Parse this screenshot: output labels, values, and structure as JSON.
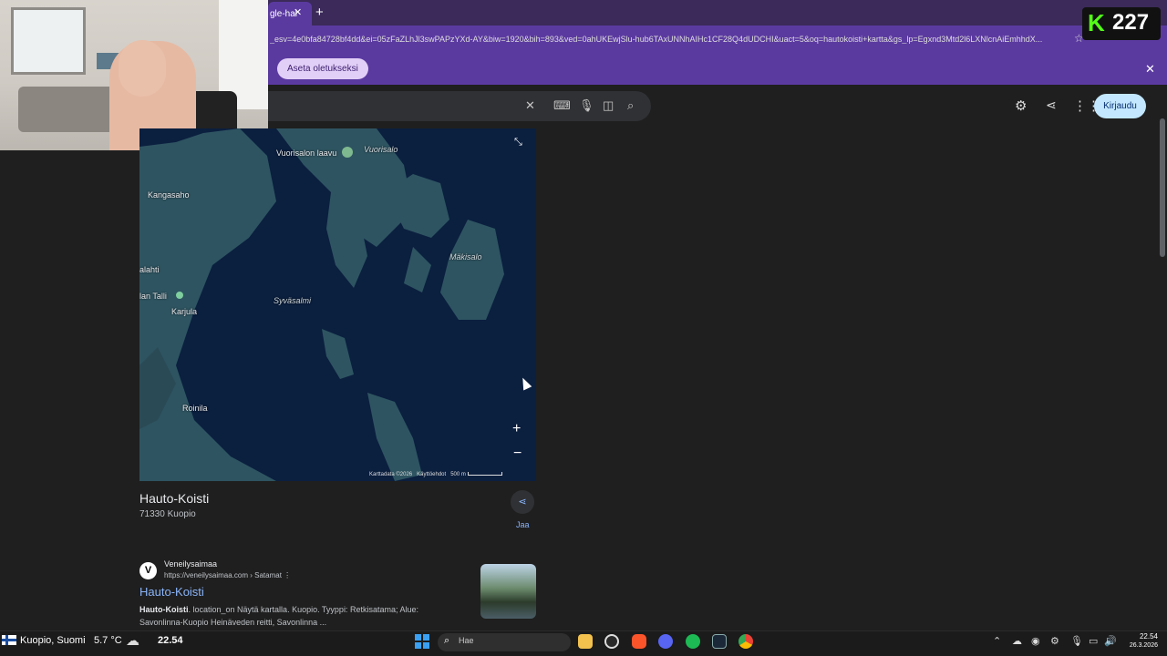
{
  "browser": {
    "tab_title": "gle-hal",
    "url": "_esv=4e0bfa84728bf4dd&ei=05zFaZLhJl3swPAPzYXd-AY&biw=1920&bih=893&ved=0ahUKEwjSlu-hub6TAxUNNhAIHc1CF28Q4dUDCHI&uact=5&oq=hautokoisti+kartta&gs_lp=Egxnd3Mtd2l6LXNlcnAiEmhhdX...",
    "set_default_label": "Aseta oletukseksi"
  },
  "kick": {
    "count": "227",
    "logo_letter": "K"
  },
  "google": {
    "signin_label": "Kirjaudu"
  },
  "map": {
    "labels": {
      "vuorisalon_laavu": "Vuorisalon laavu",
      "vuorisalo": "Vuorisalo",
      "kangasaho": "Kangasaho",
      "makisalo": "Mäkisalo",
      "lahti": "alahti",
      "talli": "lan Talli",
      "karjula": "Karjula",
      "syvasalmi": "Syväsalmi",
      "roinila": "Roinila"
    },
    "footer": {
      "data": "Karttadata ©2026",
      "terms": "Käyttöehdot",
      "scale": "500 m"
    }
  },
  "place": {
    "name": "Hauto-Koisti",
    "address": "71330 Kuopio",
    "share_label": "Jaa"
  },
  "result": {
    "site_name": "Veneilysaimaa",
    "url": "https://veneilysaimaa.com › Satamat",
    "title": "Hauto-Koisti",
    "desc_bold": "Hauto-Koisti",
    "desc": ". location_on Näytä kartalla. Kuopio. Tyyppi: Retkisatama; Alue: Savonlinna-Kuopio Heinäveden reitti, Savonlinna ..."
  },
  "taskbar": {
    "location": "Kuopio, Suomi",
    "temp": "5.7 °C",
    "time_left": "22.54",
    "search_text": "Hae",
    "clock_time": "22.54",
    "clock_date": "26.3.2026"
  }
}
